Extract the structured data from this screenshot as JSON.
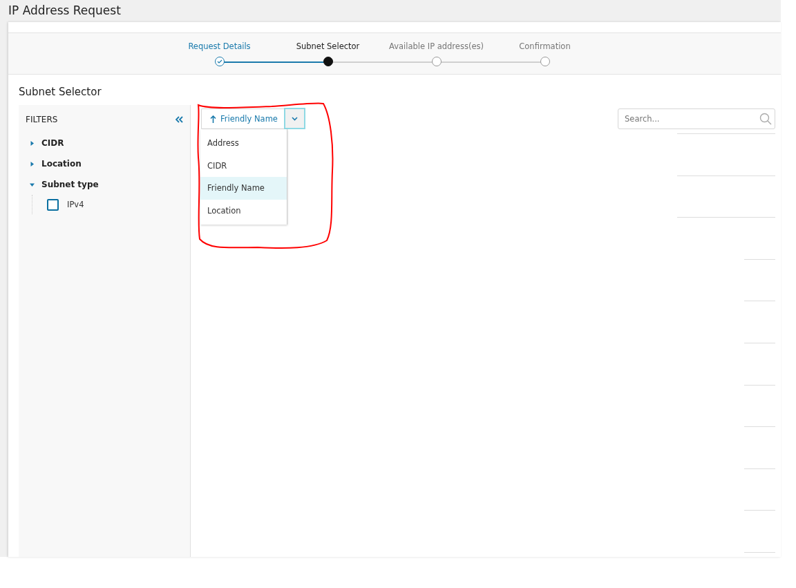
{
  "page_title": "IP Address Request",
  "steps": [
    {
      "label": "Request Details",
      "completed": true,
      "selected": false
    },
    {
      "label": "Subnet Selector",
      "completed": false,
      "selected": true
    },
    {
      "label": "Available IP address(es)",
      "completed": false,
      "selected": false
    },
    {
      "label": "Confirmation",
      "completed": false,
      "selected": false
    }
  ],
  "section_title": "Subnet Selector",
  "filters": {
    "title": "FILTERS",
    "groups": [
      {
        "label": "CIDR",
        "expanded": false
      },
      {
        "label": "Location",
        "expanded": false
      },
      {
        "label": "Subnet type",
        "expanded": true,
        "children": [
          {
            "label": "IPv4",
            "checked": false
          }
        ]
      }
    ]
  },
  "sort": {
    "label": "Friendly Name",
    "ascending": true,
    "menu_open": true,
    "options": [
      {
        "label": "Address",
        "selected": false
      },
      {
        "label": "CIDR",
        "selected": false
      },
      {
        "label": "Friendly Name",
        "selected": true
      },
      {
        "label": "Location",
        "selected": false
      }
    ]
  },
  "search": {
    "placeholder": "Search..."
  },
  "annotation": {
    "kind": "outline",
    "color": "#ff0000"
  }
}
